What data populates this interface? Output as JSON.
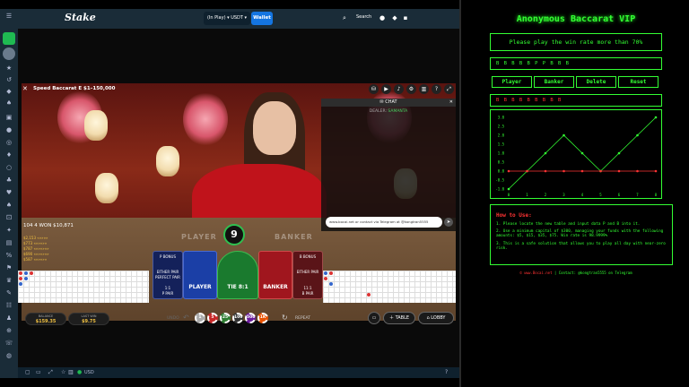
{
  "browser": {
    "logo": "Stake",
    "wallet_selector": "(In Play) ▾ USDT ▾",
    "wallet_button": "Wallet",
    "search_label": "Search",
    "footer_currency": "USD"
  },
  "game": {
    "title": "Speed Baccarat E",
    "limits": "$1–150,000",
    "timer": "9",
    "win_line": "104 4  WON $10,871",
    "winners": [
      "$2,153 «»»»»",
      "$773 «»»»»»",
      "$787 «»»»»»»",
      "$690 «»»»»»»",
      "$587 «»»»»»"
    ],
    "felt_player": "PLAYER",
    "felt_banker": "BANKER",
    "bets": {
      "p_bonus": "P BONUS",
      "either_pair": "EITHER PAIR",
      "perfect_pair": "PERFECT PAIR",
      "p_pair": "P PAIR",
      "player": "PLAYER",
      "tie": "TIE 8:1",
      "banker": "BANKER",
      "b_bonus": "B BONUS",
      "b_pair": "B PAIR",
      "p_odds": "1:1",
      "b_odds": "11:1"
    },
    "chat": {
      "title": "CHAT",
      "dealer_label": "DEALER:",
      "dealer_name": "SAMANTA",
      "input_text": "www.bocai.net or contact via Telegram at @kongtran5555"
    },
    "controls": {
      "undo": "UNDO",
      "repeat": "REPEAT",
      "table": "TABLE",
      "lobby": "LOBBY"
    },
    "chips": [
      "1",
      "5",
      "25",
      "100",
      "500",
      "1K"
    ],
    "balance": {
      "label": "BALANCE",
      "value": "$159.35"
    },
    "last_win": {
      "label": "LAST WIN",
      "value": "$9.75"
    }
  },
  "vip": {
    "title": "Anonymous Baccarat VIP",
    "banner": "Please play the win rate more than 70%",
    "history_row": "B B B B B P P B B B",
    "buttons": [
      "Player",
      "Banker",
      "Delete",
      "Reset"
    ],
    "predict_row": "B   B B B B B   B B B",
    "howto": {
      "heading": "How to Use:",
      "steps": [
        "1.  Please locate the new table and input data P and B into it.",
        "2.  Use a minimum capital of $300, managing your funds with the following amounts: $5, $15, $35, $75.   Win rate is 98.9999%",
        "3.  This is a safe solution that allows you to play all day with near-zero risk."
      ]
    },
    "contact_prefix": "© www.Bocai.net",
    "contact_rest": " | Contact: @kongtran5555 on Telegram",
    "chart_data": {
      "type": "line",
      "x": [
        0,
        1,
        2,
        3,
        4,
        5,
        6,
        7,
        8
      ],
      "series": [
        {
          "values": [
            -1,
            0,
            1,
            2,
            1,
            0,
            1,
            2,
            3
          ],
          "color": "#33ff33"
        },
        {
          "values": [
            0,
            0,
            0,
            0,
            0,
            0,
            0,
            0,
            0
          ],
          "color": "#ff3333"
        }
      ],
      "xlim": [
        0,
        8
      ],
      "ylim": [
        -1,
        3
      ],
      "yticks": [
        "3.0",
        "2.5",
        "2.0",
        "1.5",
        "1.0",
        "0.5",
        "0.0",
        "-0.5",
        "-1.0"
      ],
      "xticks": [
        "0",
        "1",
        "2",
        "3",
        "4",
        "5",
        "6",
        "7",
        "8"
      ],
      "grid": false
    }
  }
}
